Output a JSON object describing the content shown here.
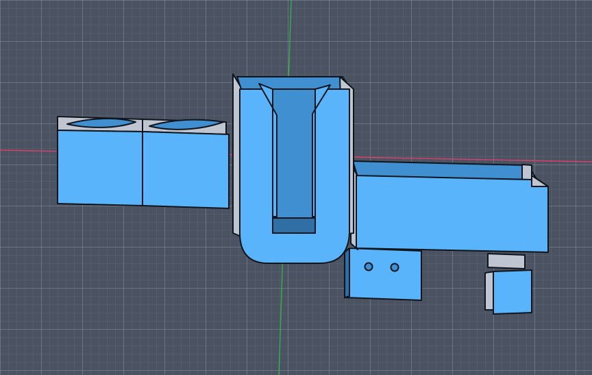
{
  "viewport": {
    "background": "#4b5262",
    "grid_minor_color": "#7a8292",
    "grid_major_color": "#9aa2b0",
    "x_axis_color": "#d9416b",
    "y_axis_color": "#2fb34a"
  },
  "model": {
    "face_color": "#5ab4fb",
    "inner_color": "#3f8fd1",
    "shadow_color": "#2f6fa6",
    "wall_color": "#bfc6d1",
    "edge_color": "#10151c",
    "parts": [
      "airfoil-block-left",
      "airfoil-block-right",
      "funnel-holder",
      "tray",
      "mounting-bracket",
      "small-clip-block"
    ]
  }
}
